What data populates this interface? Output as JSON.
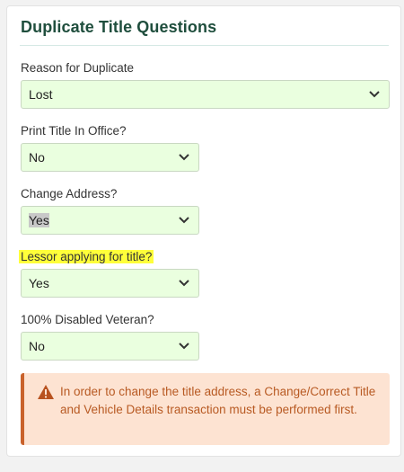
{
  "section": {
    "title": "Duplicate Title Questions"
  },
  "fields": [
    {
      "label": "Reason for Duplicate",
      "value": "Lost"
    },
    {
      "label": "Print Title In Office?",
      "value": "No"
    },
    {
      "label": "Change Address?",
      "value": "Yes"
    },
    {
      "label": "Lessor applying for title?",
      "value": "Yes"
    },
    {
      "label": "100% Disabled Veteran?",
      "value": "No"
    }
  ],
  "alert": {
    "icon": "warning-triangle-icon",
    "text": "In order to change the title address, a Change/Correct Title and Vehicle Details transaction must be performed first."
  },
  "colors": {
    "select_bg": "#eaffdf",
    "title": "#1f4e3d",
    "alert_bg": "#fde3d2",
    "alert_border": "#c9622b",
    "alert_text": "#b85a23",
    "label_highlight": "#ffff3a"
  }
}
